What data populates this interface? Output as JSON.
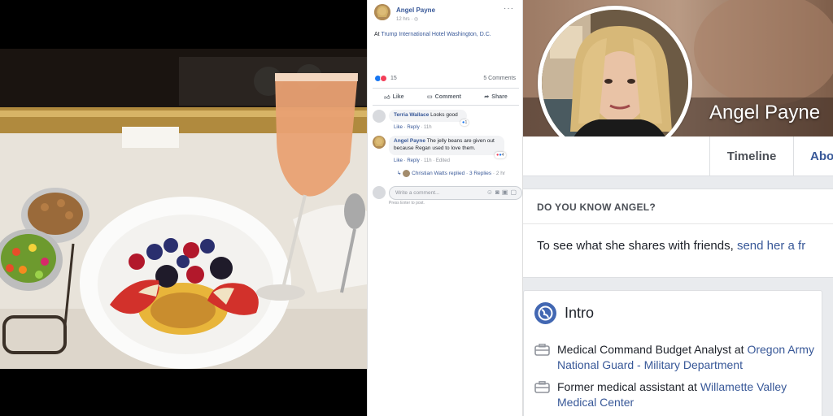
{
  "post": {
    "author": "Angel Payne",
    "time": "12 hrs · ",
    "more": "···",
    "checkin_prefix": "At ",
    "checkin_location": "Trump International Hotel Washington, D.C.",
    "reactions_count": "15",
    "comments_count": "5 Comments",
    "actions": {
      "like": "Like",
      "comment": "Comment",
      "share": "Share"
    }
  },
  "comments": [
    {
      "name": "Terria Wallace",
      "text": " Looks good",
      "meta_like": "Like",
      "meta_reply": " · Reply",
      "meta_time": " · 11h",
      "react_count": "1"
    },
    {
      "name": "Angel Payne",
      "text": " The jelly beans are given out because Regan used to love them.",
      "meta_like": "Like",
      "meta_reply": " · Reply",
      "meta_time": " · 11h · Edited",
      "react_count": "4"
    }
  ],
  "replies": {
    "arrow": "↳",
    "who": "Christian Watts replied",
    "count": " · 3 Replies",
    "time": " · 2 hr"
  },
  "write": {
    "placeholder": "Write a comment...",
    "hint": "Press Enter to post."
  },
  "profile": {
    "name": "Angel Payne",
    "tab_timeline": "Timeline",
    "tab_about": "Abo",
    "know_title": "DO YOU KNOW ANGEL?",
    "know_text": "To see what she shares with friends, ",
    "know_link": "send her a fr",
    "intro_title": "Intro",
    "intro_items": [
      {
        "prefix": "Medical Command Budget Analyst at ",
        "link": "Oregon Army National Guard - Military Department"
      },
      {
        "prefix": "Former medical assistant at ",
        "link": "Willamette Valley Medical Center"
      }
    ]
  },
  "colors": {
    "fb_blue": "#385898",
    "brand_blue": "#4267b2",
    "like_blue": "#1877f2",
    "love_red": "#f33e58"
  },
  "icons": [
    "like-icon",
    "love-icon",
    "comment-icon",
    "share-icon",
    "globe-icon",
    "briefcase-icon",
    "emoji-icon",
    "camera-icon",
    "gif-icon",
    "sticker-icon",
    "more-icon",
    "reply-arrow-icon"
  ]
}
